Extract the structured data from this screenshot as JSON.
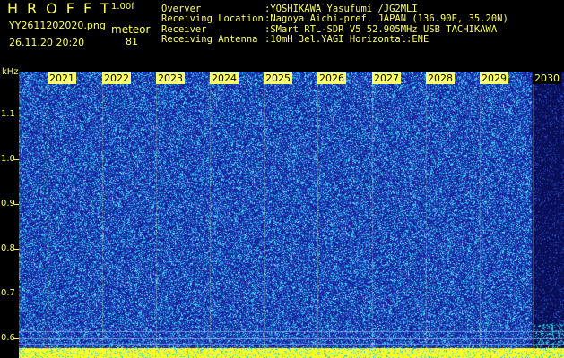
{
  "header": {
    "brand": "HROFFT",
    "version": "1.00f",
    "filename": "YY2611202020.png",
    "datetime": "26.11.20 20:20",
    "mode": "meteor",
    "count": "81"
  },
  "station_info": [
    {
      "label": "Overver",
      "value": ":YOSHIKAWA Yasufumi /JG2MLI"
    },
    {
      "label": "Receiving Location",
      "value": ":Nagoya Aichi-pref. JAPAN (136.90E, 35.20N)"
    },
    {
      "label": "Receiver",
      "value": ":SMart RTL-SDR V5 52.905MHz USB TACHIKAWA"
    },
    {
      "label": "Receiving Antenna",
      "value": ":10mH 3el.YAGI Horizontal:ENE"
    }
  ],
  "axis": {
    "unit": "kHz",
    "y_ticks": [
      "1.1",
      "1.0",
      "0.9",
      "0.8",
      "0.7",
      "0.6"
    ],
    "x_labels": [
      "2021",
      "2022",
      "2023",
      "2024",
      "2025",
      "2026",
      "2027",
      "2028",
      "2029",
      "2030"
    ]
  },
  "colors": {
    "text": "#ffff66",
    "background": "#000000",
    "waterfall_base": "#1a2fa8",
    "waterfall_noise": "#27c8e6",
    "bottom_band": "#ffff33"
  }
}
